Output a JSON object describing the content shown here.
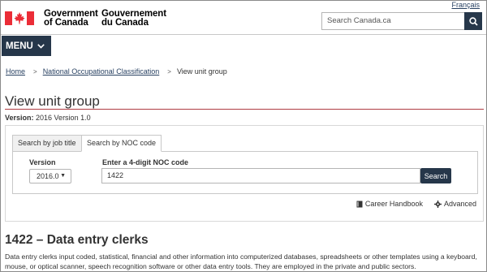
{
  "header": {
    "language_link": "Français",
    "wordmark_en": [
      "Government",
      "of Canada"
    ],
    "wordmark_fr": [
      "Gouvernement",
      "du Canada"
    ],
    "search_placeholder": "Search Canada.ca",
    "menu_label": "MENU"
  },
  "breadcrumb": {
    "items": [
      "Home",
      "National Occupational Classification"
    ],
    "current": "View unit group"
  },
  "page": {
    "title": "View unit group",
    "version_label": "Version:",
    "version_value": "2016 Version 1.0"
  },
  "search_panel": {
    "tabs": [
      "Search by job title",
      "Search by NOC code"
    ],
    "version_label": "Version",
    "version_selected": "2016.0",
    "noc_label": "Enter a 4-digit NOC code",
    "noc_value": "1422",
    "search_button": "Search",
    "links": [
      "Career Handbook",
      "Advanced"
    ]
  },
  "result": {
    "title": "1422 – Data entry clerks",
    "description": "Data entry clerks input coded, statistical, financial and other information into computerized databases, spreadsheets or other templates using a keyboard, mouse, or optical scanner, speech recognition software or other data entry tools. They are employed in the private and public sectors."
  },
  "colors": {
    "brand_dark": "#26374a",
    "flag_red": "#eb2d37",
    "title_rule": "#af3c43",
    "link": "#284162"
  }
}
